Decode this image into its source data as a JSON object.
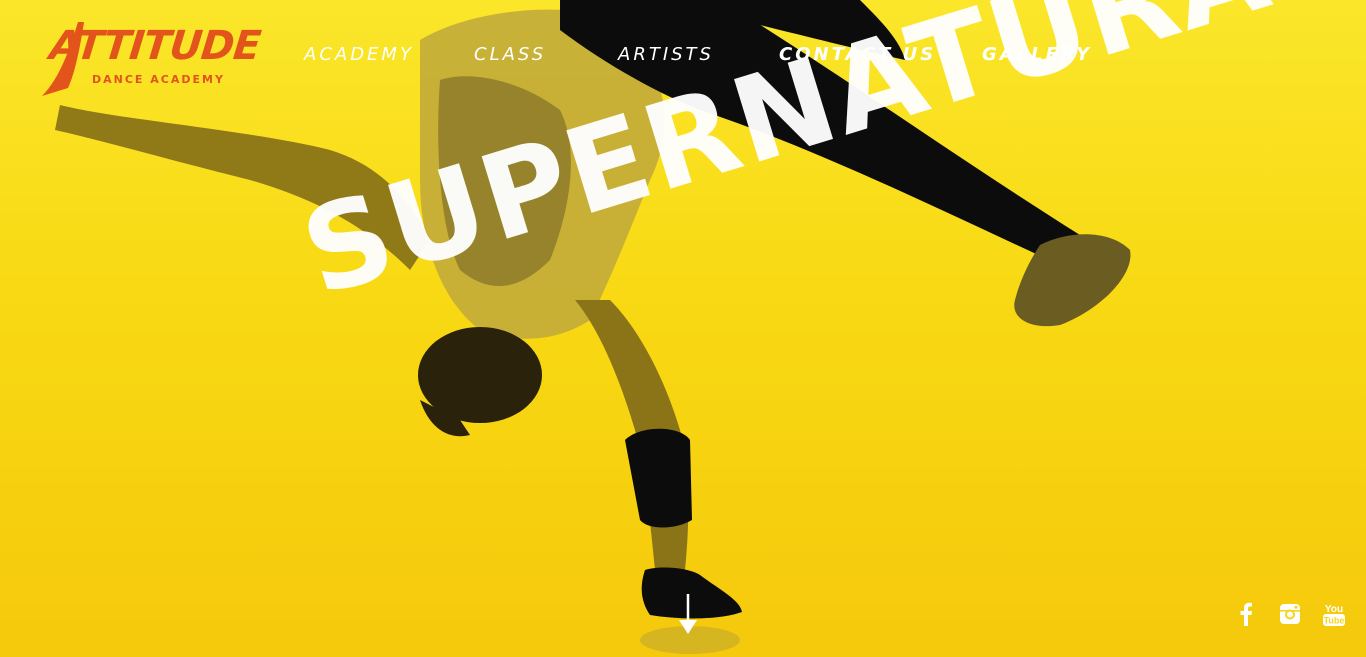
{
  "brand": {
    "name": "ATTITUDE",
    "tagline": "DANCE ACADEMY",
    "color": "#e2541c"
  },
  "nav": {
    "items": [
      {
        "label": "ACADEMY"
      },
      {
        "label": "CLASS"
      },
      {
        "label": "ARTISTS"
      },
      {
        "label": "CONTACT US"
      },
      {
        "label": "GALLERY"
      }
    ]
  },
  "hero": {
    "headline": "SUPERNATURAL",
    "background_color": "#f8d913",
    "scroll_icon": "arrow-down-icon"
  },
  "social": {
    "icons": [
      "facebook-icon",
      "instagram-icon",
      "youtube-icon"
    ],
    "youtube_text": "You Tube"
  }
}
